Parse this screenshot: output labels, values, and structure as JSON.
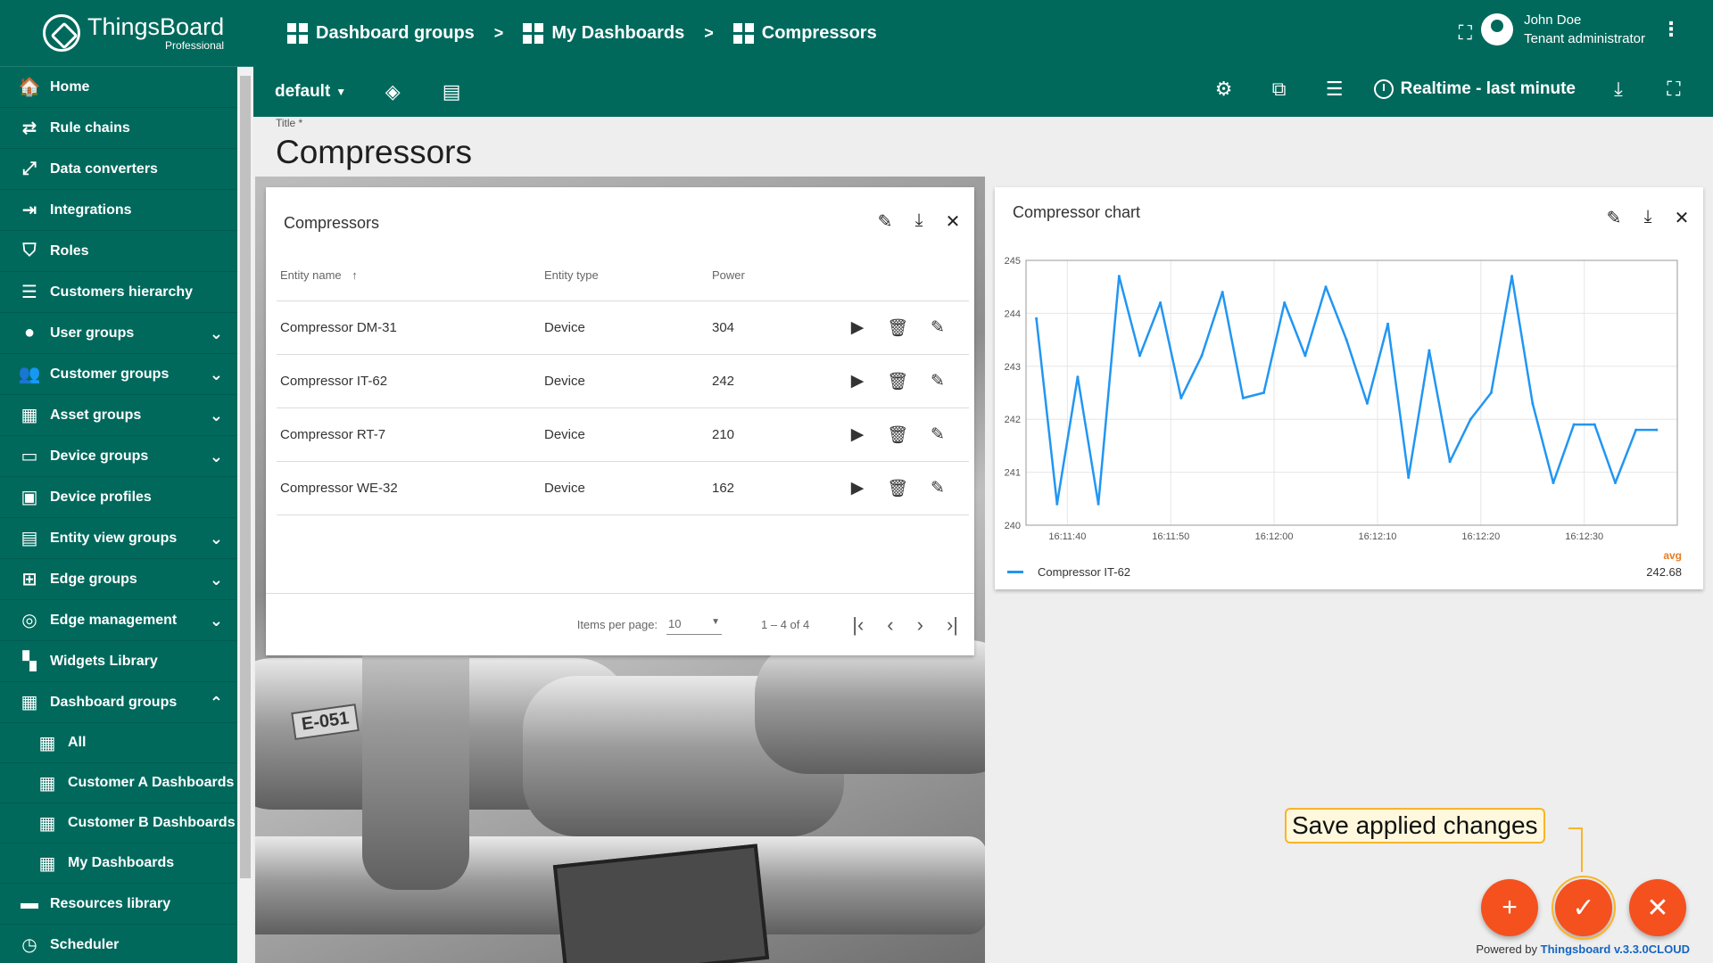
{
  "logo": {
    "name": "ThingsBoard",
    "edition": "Professional"
  },
  "sidebar": {
    "items": [
      {
        "label": "Home",
        "icon": "🏠",
        "name": "home"
      },
      {
        "label": "Rule chains",
        "icon": "⇄",
        "name": "rule-chains"
      },
      {
        "label": "Data converters",
        "icon": "⤢",
        "name": "data-converters"
      },
      {
        "label": "Integrations",
        "icon": "⇥",
        "name": "integrations"
      },
      {
        "label": "Roles",
        "icon": "⛉",
        "name": "roles"
      },
      {
        "label": "Customers hierarchy",
        "icon": "☰",
        "name": "customers-hierarchy"
      },
      {
        "label": "User groups",
        "icon": "●",
        "name": "user-groups",
        "chevron": "⌄"
      },
      {
        "label": "Customer groups",
        "icon": "👥",
        "name": "customer-groups",
        "chevron": "⌄"
      },
      {
        "label": "Asset groups",
        "icon": "▦",
        "name": "asset-groups",
        "chevron": "⌄"
      },
      {
        "label": "Device groups",
        "icon": "▭",
        "name": "device-groups",
        "chevron": "⌄"
      },
      {
        "label": "Device profiles",
        "icon": "▣",
        "name": "device-profiles"
      },
      {
        "label": "Entity view groups",
        "icon": "▤",
        "name": "entity-view-groups",
        "chevron": "⌄"
      },
      {
        "label": "Edge groups",
        "icon": "⊞",
        "name": "edge-groups",
        "chevron": "⌄"
      },
      {
        "label": "Edge management",
        "icon": "◎",
        "name": "edge-management",
        "chevron": "⌄"
      },
      {
        "label": "Widgets Library",
        "icon": "▚",
        "name": "widgets-library"
      },
      {
        "label": "Dashboard groups",
        "icon": "▦",
        "name": "dashboard-groups",
        "chevron": "⌃"
      },
      {
        "label": "All",
        "icon": "▦",
        "name": "all",
        "sub": true
      },
      {
        "label": "Customer A Dashboards",
        "icon": "▦",
        "name": "customer-a-dashboards",
        "sub": true
      },
      {
        "label": "Customer B Dashboards",
        "icon": "▦",
        "name": "customer-b-dashboards",
        "sub": true
      },
      {
        "label": "My Dashboards",
        "icon": "▦",
        "name": "my-dashboards",
        "sub": true
      },
      {
        "label": "Resources library",
        "icon": "▬",
        "name": "resources-library"
      },
      {
        "label": "Scheduler",
        "icon": "◷",
        "name": "scheduler"
      }
    ]
  },
  "breadcrumbs": [
    "Dashboard groups",
    "My Dashboards",
    "Compressors"
  ],
  "breadcrumb_separator": ">",
  "user": {
    "name": "John Doe",
    "role": "Tenant administrator"
  },
  "toolbar": {
    "layout": "default",
    "timewindow": "Realtime - last minute"
  },
  "dashboard": {
    "title_label": "Title *",
    "title": "Compressors"
  },
  "table_widget": {
    "title": "Compressors",
    "columns": [
      "Entity name",
      "Entity type",
      "Power"
    ],
    "sort_indicator": "↑",
    "rows": [
      [
        "Compressor DM-31",
        "Device",
        "304"
      ],
      [
        "Compressor IT-62",
        "Device",
        "242"
      ],
      [
        "Compressor RT-7",
        "Device",
        "210"
      ],
      [
        "Compressor WE-32",
        "Device",
        "162"
      ]
    ],
    "paginator": {
      "items_per_page_label": "Items per page:",
      "page_size": "10",
      "range": "1 – 4 of 4"
    }
  },
  "chart_widget": {
    "title": "Compressor chart"
  },
  "chart_data": {
    "type": "line",
    "ylim": [
      240,
      245
    ],
    "yticks": [
      "240",
      "241",
      "242",
      "243",
      "244",
      "245"
    ],
    "xticks": [
      "16:11:40",
      "16:11:50",
      "16:12:00",
      "16:12:10",
      "16:12:20",
      "16:12:30"
    ],
    "xlim_seconds": [
      -4,
      59
    ],
    "series": [
      {
        "name": "Compressor IT-62",
        "color": "#2196f3",
        "x": [
          -3,
          -1,
          1,
          3,
          5,
          7,
          9,
          11,
          13,
          15,
          17,
          19,
          21,
          23,
          25,
          27,
          29,
          31,
          33,
          35,
          37,
          39,
          41,
          43,
          45,
          47,
          49,
          51,
          53,
          55,
          57
        ],
        "y": [
          243.9,
          240.4,
          242.8,
          240.4,
          244.7,
          243.2,
          244.2,
          242.4,
          243.2,
          244.4,
          242.4,
          242.5,
          244.2,
          243.2,
          244.5,
          243.5,
          242.3,
          243.8,
          240.9,
          243.3,
          241.2,
          242.0,
          242.5,
          244.7,
          242.3,
          240.8,
          241.9,
          241.9,
          240.8,
          241.8,
          241.8
        ]
      }
    ],
    "legend": {
      "stat_label": "avg",
      "stat_value": "242.68"
    },
    "grid": true
  },
  "tip": {
    "text": "Save applied changes"
  },
  "fabs": {
    "add": "+",
    "save": "✓",
    "cancel": "✕"
  },
  "footer": {
    "prefix": "Powered by",
    "brand": "Thingsboard v.3.3.0CLOUD"
  }
}
